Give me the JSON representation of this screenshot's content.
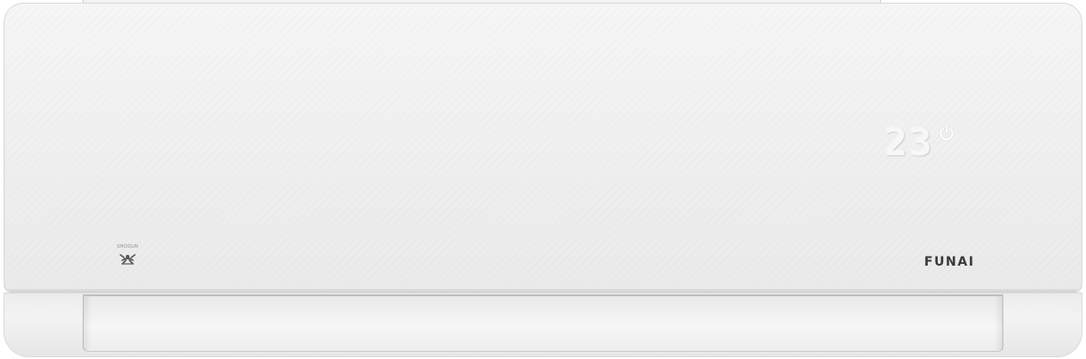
{
  "display": {
    "temperature": "23",
    "power_icon": "power-icon"
  },
  "logos": {
    "shogun_text": "SHOGUN",
    "shogun_mark_icon": "shogun-crest-icon",
    "brand": "FUNAI"
  },
  "colors": {
    "body": "#f0f0f0",
    "display_glow": "#f7f7f7",
    "brand_text": "#3a3a3a"
  }
}
